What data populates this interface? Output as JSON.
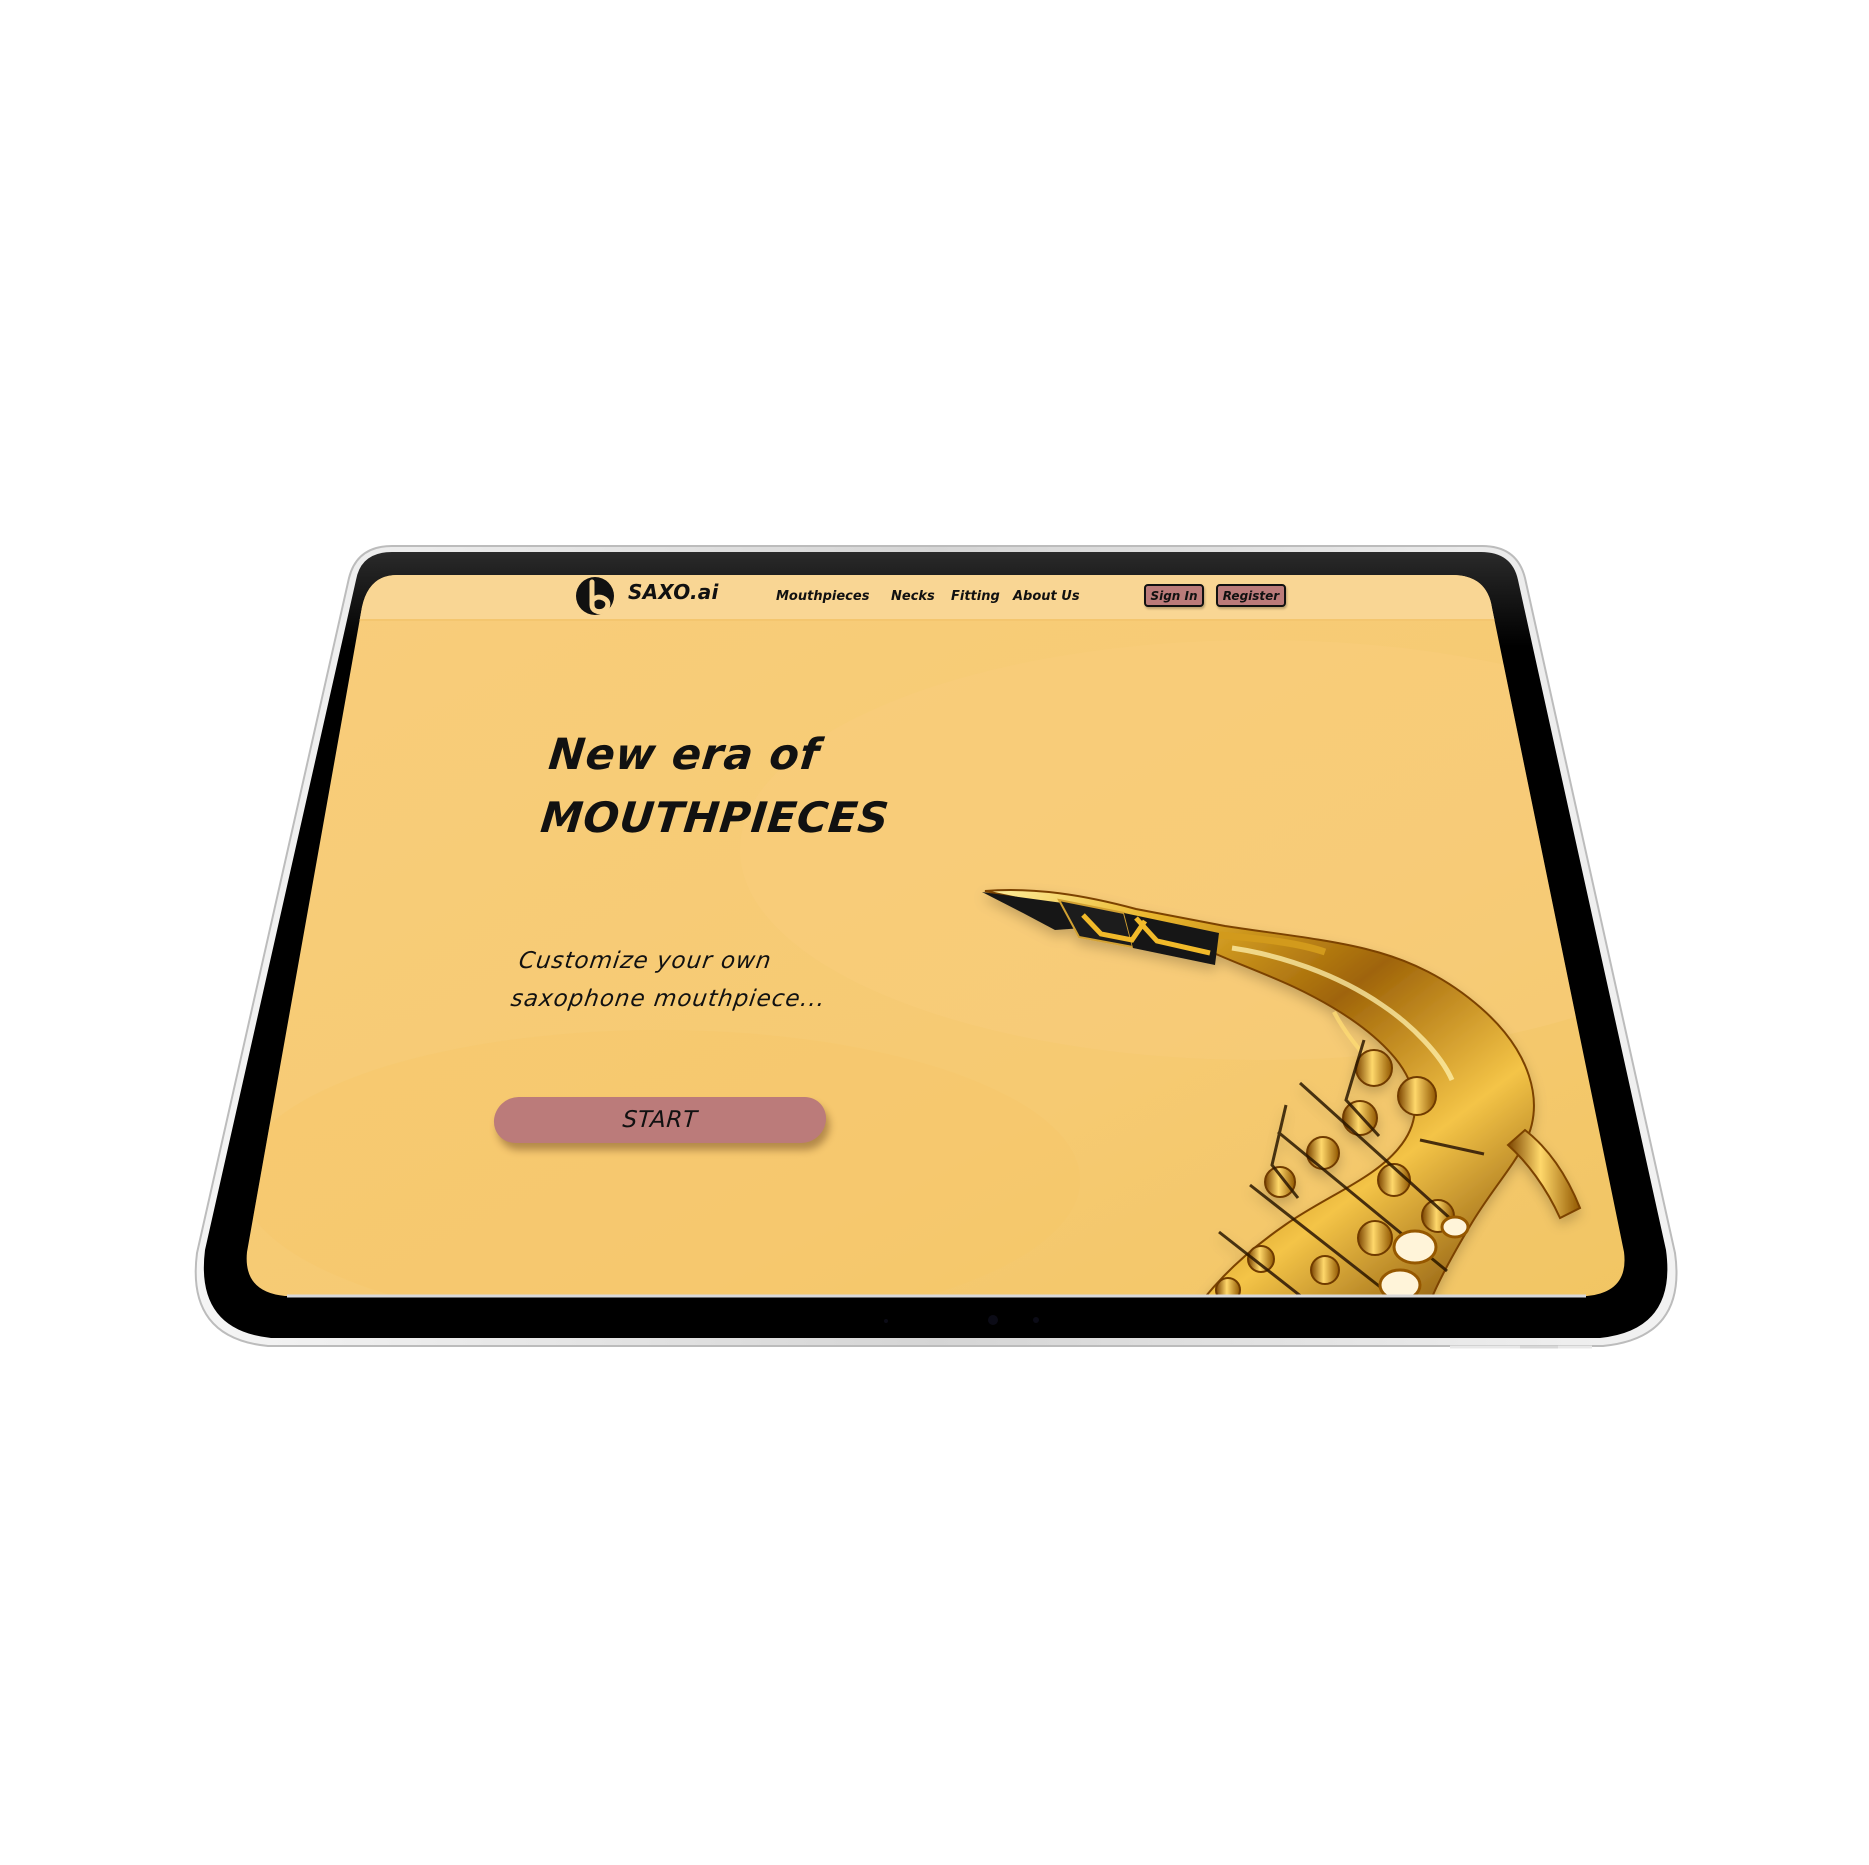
{
  "app": {
    "brand": "SAXO.ai",
    "logo_icon": "note-logo-icon"
  },
  "navigation": {
    "items": [
      {
        "label": "Mouthpieces"
      },
      {
        "label": "Necks"
      },
      {
        "label": "Fitting"
      },
      {
        "label": "About Us"
      }
    ],
    "sign_in": "Sign In",
    "register": "Register"
  },
  "hero": {
    "title_line_1": "New era of",
    "title_line_2": "MOUTHPIECES",
    "subtitle_line_1": "Customize your own",
    "subtitle_line_2": "saxophone mouthpiece...",
    "cta": "START",
    "image_icon": "saxophone-icon"
  },
  "colors": {
    "background": "#ffffff",
    "device_frame": "#000000",
    "device_silver": "#d8d8d8",
    "page_bg": "#f6ca74",
    "header_bg": "#f9d694",
    "button": "#bb7b7a",
    "text": "#111111",
    "gold": "#d6a525"
  }
}
